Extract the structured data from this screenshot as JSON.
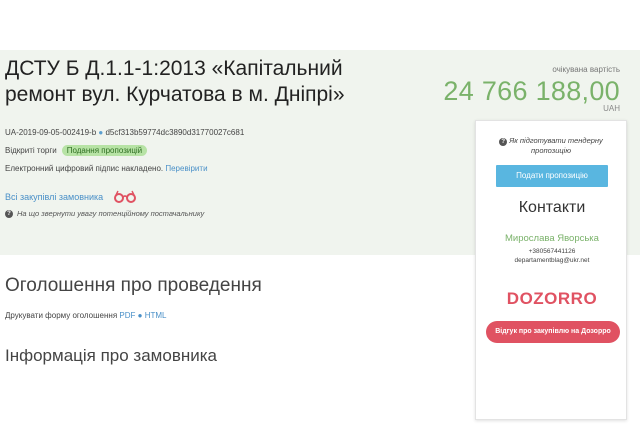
{
  "tender": {
    "title": "ДСТУ Б Д.1.1-1:2013 «Капітальний ремонт вул. Курчатова в м. Дніпрі»",
    "value_caption": "очікувана вартість",
    "value_amount": "24 766 188,00",
    "value_currency": "UAH",
    "id": "UA-2019-09-05-002419-b",
    "hash": "d5cf313b59774dc3890d31770027c681",
    "procedure": "Відкриті торги",
    "status": "Подання пропозицій",
    "signature_text": "Електронний цифровий підпис накладено.",
    "signature_link": "Перевірити",
    "all_purchases": "Всі закупівлі замовника",
    "hint": "На що звернути увагу потенційному постачальнику"
  },
  "sidebar": {
    "prep_link": "Як підготувати тендерну пропозицію",
    "submit_label": "Подати пропозицію",
    "contacts_title": "Контакти",
    "contact_name": "Мирослава Яворська",
    "contact_phone": "+380567441126",
    "contact_email": "departamentblag@ukr.net",
    "dozorro_logo": "DOZORRO",
    "dozorro_button": "Відгук про закупівлю на Дозорро"
  },
  "announcement": {
    "heading": "Оголошення про проведення",
    "print_label": "Друкувати форму оголошення",
    "pdf_link": "PDF",
    "html_link": "HTML"
  },
  "customer": {
    "heading": "Інформація про замовника"
  },
  "colors": {
    "accent_green": "#7ab26a",
    "link_blue": "#4a90c8",
    "dozorro_red": "#e05262",
    "button_blue": "#59b6e0"
  }
}
